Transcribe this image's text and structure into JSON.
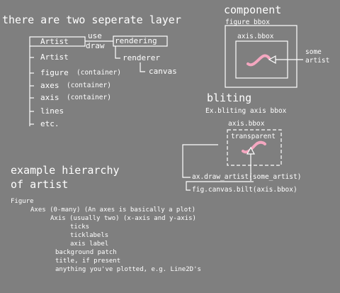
{
  "colors": {
    "background": "#7f7f7f",
    "line": "#ffffff",
    "artist": "#f4a7c0"
  },
  "titles": {
    "layers": "there are two seperate layer",
    "component": "component",
    "bliting": "bliting",
    "hierarchy_line1": "example hierarchy",
    "hierarchy_line2": "of artist"
  },
  "layers": {
    "artist_box": "Artist",
    "use": "use",
    "draw": "draw",
    "rendering_box": "rendering",
    "renderer": "renderer",
    "canvas": "canvas",
    "items": [
      {
        "name": "Artist",
        "note": ""
      },
      {
        "name": "figure",
        "note": "(container)"
      },
      {
        "name": "axes",
        "note": "(container)"
      },
      {
        "name": "axis",
        "note": "(container)"
      },
      {
        "name": "lines",
        "note": ""
      },
      {
        "name": "etc.",
        "note": ""
      }
    ]
  },
  "component": {
    "figure_bbox": "figure bbox",
    "axis_bbox": "axis.bbox",
    "pointer_line1": "some",
    "pointer_line2": "artist"
  },
  "bliting": {
    "subtitle": "Ex.bliting axis bbox",
    "axis_bbox": "axis.bbox",
    "transparent": "transparent",
    "draw_artist": "ax.draw_artist(some_artist)",
    "canvas_blit": "fig.canvas.bilt(axis.bbox)"
  },
  "hierarchy": {
    "root": "Figure",
    "axes": "Axes (0-many) (An axes is basically a plot)",
    "axis": "Axis (usually two) (x-axis and y-axis)",
    "axis_children": [
      "ticks",
      "ticklabels",
      "axis label"
    ],
    "axes_children": [
      "background patch",
      "title, if present",
      "anything you've plotted, e.g. Line2D's"
    ]
  }
}
